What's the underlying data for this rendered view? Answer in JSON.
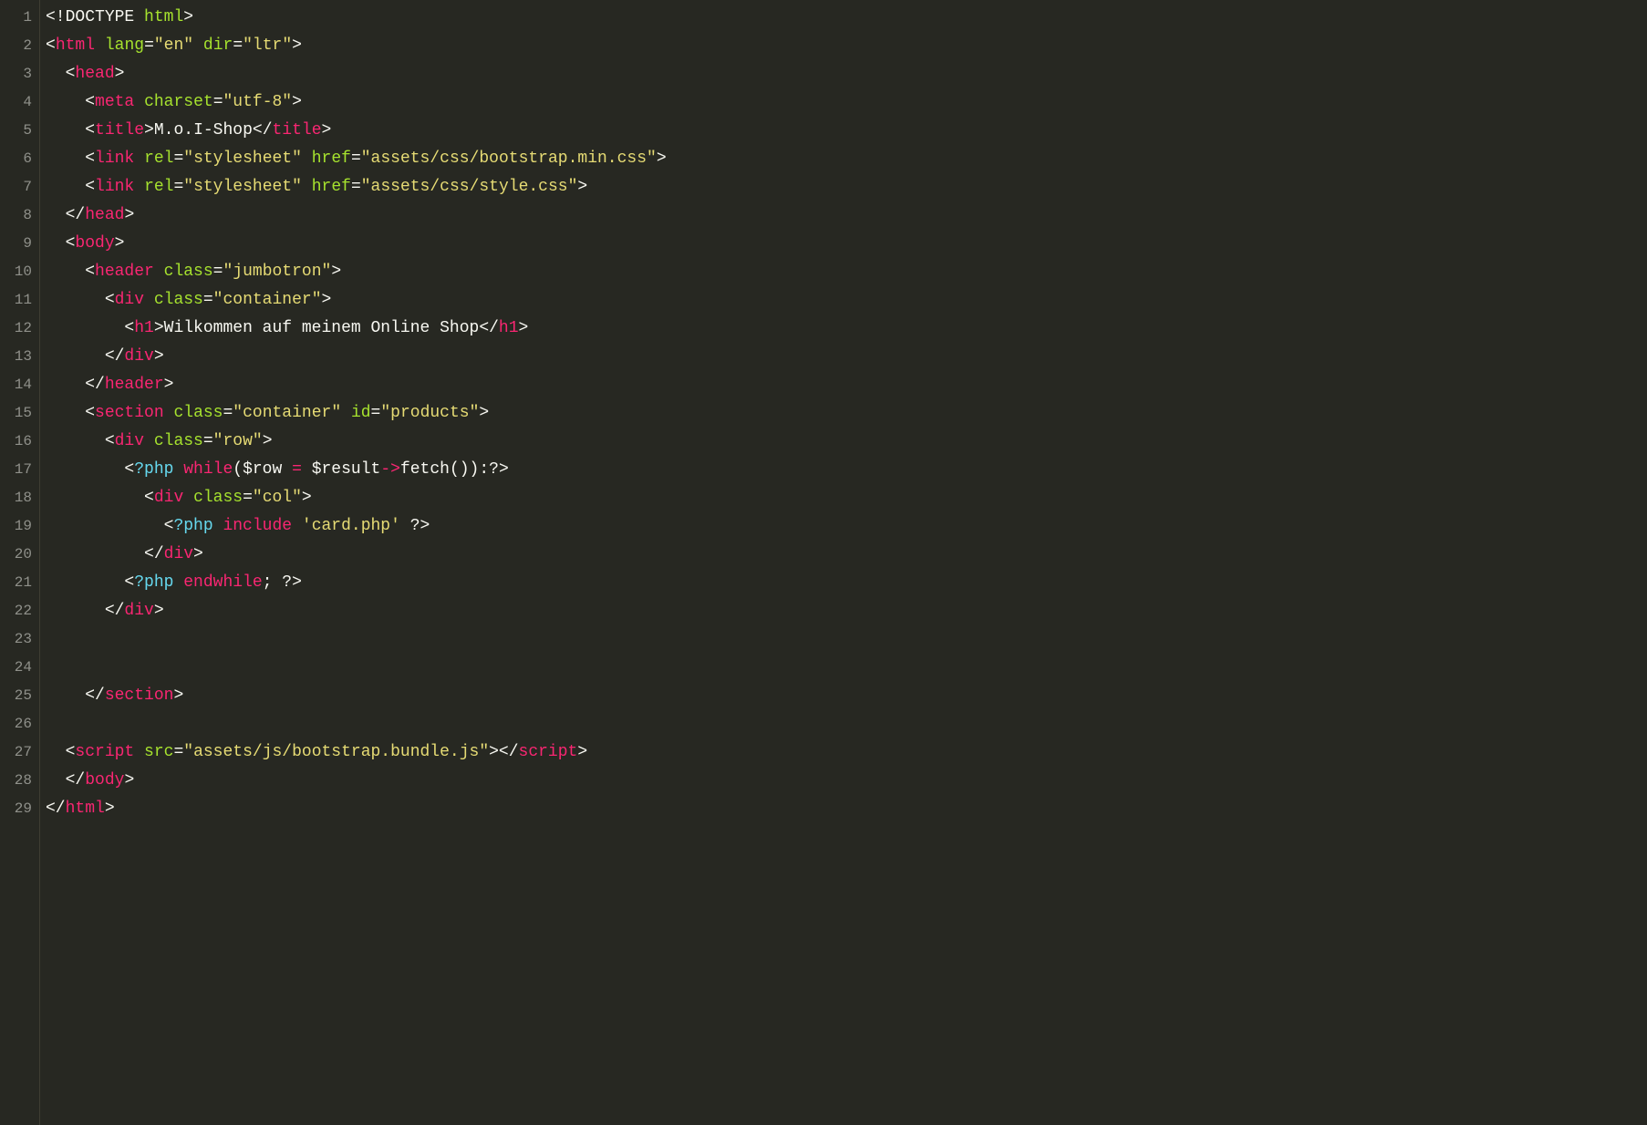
{
  "lineNumbers": [
    "1",
    "2",
    "3",
    "4",
    "5",
    "6",
    "7",
    "8",
    "9",
    "10",
    "11",
    "12",
    "13",
    "14",
    "15",
    "16",
    "17",
    "18",
    "19",
    "20",
    "21",
    "22",
    "23",
    "24",
    "25",
    "26",
    "27",
    "28",
    "29"
  ],
  "code": {
    "lines": [
      {
        "indent": "",
        "tokens": [
          {
            "cls": "pun",
            "t": "<!"
          },
          {
            "cls": "doctype",
            "t": "DOCTYPE"
          },
          {
            "cls": "pun",
            "t": " "
          },
          {
            "cls": "attr",
            "t": "html"
          },
          {
            "cls": "pun",
            "t": ">"
          }
        ]
      },
      {
        "indent": "",
        "tokens": [
          {
            "cls": "pun",
            "t": "<"
          },
          {
            "cls": "tag",
            "t": "html"
          },
          {
            "cls": "pun",
            "t": " "
          },
          {
            "cls": "attr",
            "t": "lang"
          },
          {
            "cls": "pun",
            "t": "="
          },
          {
            "cls": "str",
            "t": "\"en\""
          },
          {
            "cls": "pun",
            "t": " "
          },
          {
            "cls": "attr",
            "t": "dir"
          },
          {
            "cls": "pun",
            "t": "="
          },
          {
            "cls": "str",
            "t": "\"ltr\""
          },
          {
            "cls": "pun",
            "t": ">"
          }
        ]
      },
      {
        "indent": "  ",
        "tokens": [
          {
            "cls": "pun",
            "t": "<"
          },
          {
            "cls": "tag",
            "t": "head"
          },
          {
            "cls": "pun",
            "t": ">"
          }
        ]
      },
      {
        "indent": "    ",
        "tokens": [
          {
            "cls": "pun",
            "t": "<"
          },
          {
            "cls": "tag",
            "t": "meta"
          },
          {
            "cls": "pun",
            "t": " "
          },
          {
            "cls": "attr",
            "t": "charset"
          },
          {
            "cls": "pun",
            "t": "="
          },
          {
            "cls": "str",
            "t": "\"utf-8\""
          },
          {
            "cls": "pun",
            "t": ">"
          }
        ]
      },
      {
        "indent": "    ",
        "tokens": [
          {
            "cls": "pun",
            "t": "<"
          },
          {
            "cls": "tag",
            "t": "title"
          },
          {
            "cls": "pun",
            "t": ">"
          },
          {
            "cls": "txt",
            "t": "M.o.I-Shop"
          },
          {
            "cls": "pun",
            "t": "</"
          },
          {
            "cls": "tag",
            "t": "title"
          },
          {
            "cls": "pun",
            "t": ">"
          }
        ]
      },
      {
        "indent": "    ",
        "tokens": [
          {
            "cls": "pun",
            "t": "<"
          },
          {
            "cls": "tag",
            "t": "link"
          },
          {
            "cls": "pun",
            "t": " "
          },
          {
            "cls": "attr",
            "t": "rel"
          },
          {
            "cls": "pun",
            "t": "="
          },
          {
            "cls": "str",
            "t": "\"stylesheet\""
          },
          {
            "cls": "pun",
            "t": " "
          },
          {
            "cls": "attr",
            "t": "href"
          },
          {
            "cls": "pun",
            "t": "="
          },
          {
            "cls": "str",
            "t": "\"assets/css/bootstrap.min.css\""
          },
          {
            "cls": "pun",
            "t": ">"
          }
        ]
      },
      {
        "indent": "    ",
        "tokens": [
          {
            "cls": "pun",
            "t": "<"
          },
          {
            "cls": "tag",
            "t": "link"
          },
          {
            "cls": "pun",
            "t": " "
          },
          {
            "cls": "attr",
            "t": "rel"
          },
          {
            "cls": "pun",
            "t": "="
          },
          {
            "cls": "str",
            "t": "\"stylesheet\""
          },
          {
            "cls": "pun",
            "t": " "
          },
          {
            "cls": "attr",
            "t": "href"
          },
          {
            "cls": "pun",
            "t": "="
          },
          {
            "cls": "str",
            "t": "\"assets/css/style.css\""
          },
          {
            "cls": "pun",
            "t": ">"
          }
        ]
      },
      {
        "indent": "  ",
        "tokens": [
          {
            "cls": "pun",
            "t": "</"
          },
          {
            "cls": "tag",
            "t": "head"
          },
          {
            "cls": "pun",
            "t": ">"
          }
        ]
      },
      {
        "indent": "  ",
        "tokens": [
          {
            "cls": "pun",
            "t": "<"
          },
          {
            "cls": "tag",
            "t": "body"
          },
          {
            "cls": "pun",
            "t": ">"
          }
        ]
      },
      {
        "indent": "    ",
        "tokens": [
          {
            "cls": "pun",
            "t": "<"
          },
          {
            "cls": "tag",
            "t": "header"
          },
          {
            "cls": "pun",
            "t": " "
          },
          {
            "cls": "attr",
            "t": "class"
          },
          {
            "cls": "pun",
            "t": "="
          },
          {
            "cls": "str",
            "t": "\"jumbotron\""
          },
          {
            "cls": "pun",
            "t": ">"
          }
        ]
      },
      {
        "indent": "      ",
        "tokens": [
          {
            "cls": "pun",
            "t": "<"
          },
          {
            "cls": "tag",
            "t": "div"
          },
          {
            "cls": "pun",
            "t": " "
          },
          {
            "cls": "attr",
            "t": "class"
          },
          {
            "cls": "pun",
            "t": "="
          },
          {
            "cls": "str",
            "t": "\"container\""
          },
          {
            "cls": "pun",
            "t": ">"
          }
        ]
      },
      {
        "indent": "        ",
        "tokens": [
          {
            "cls": "pun",
            "t": "<"
          },
          {
            "cls": "tag",
            "t": "h1"
          },
          {
            "cls": "pun",
            "t": ">"
          },
          {
            "cls": "txt",
            "t": "Wilkommen auf meinem Online Shop"
          },
          {
            "cls": "pun",
            "t": "</"
          },
          {
            "cls": "tag",
            "t": "h1"
          },
          {
            "cls": "pun",
            "t": ">"
          }
        ]
      },
      {
        "indent": "      ",
        "tokens": [
          {
            "cls": "pun",
            "t": "</"
          },
          {
            "cls": "tag",
            "t": "div"
          },
          {
            "cls": "pun",
            "t": ">"
          }
        ]
      },
      {
        "indent": "    ",
        "tokens": [
          {
            "cls": "pun",
            "t": "</"
          },
          {
            "cls": "tag",
            "t": "header"
          },
          {
            "cls": "pun",
            "t": ">"
          }
        ]
      },
      {
        "indent": "    ",
        "tokens": [
          {
            "cls": "pun",
            "t": "<"
          },
          {
            "cls": "tag",
            "t": "section"
          },
          {
            "cls": "pun",
            "t": " "
          },
          {
            "cls": "attr",
            "t": "class"
          },
          {
            "cls": "pun",
            "t": "="
          },
          {
            "cls": "str",
            "t": "\"container\""
          },
          {
            "cls": "pun",
            "t": " "
          },
          {
            "cls": "attr",
            "t": "id"
          },
          {
            "cls": "pun",
            "t": "="
          },
          {
            "cls": "str",
            "t": "\"products\""
          },
          {
            "cls": "pun",
            "t": ">"
          }
        ]
      },
      {
        "indent": "      ",
        "tokens": [
          {
            "cls": "pun",
            "t": "<"
          },
          {
            "cls": "tag",
            "t": "div"
          },
          {
            "cls": "pun",
            "t": " "
          },
          {
            "cls": "attr",
            "t": "class"
          },
          {
            "cls": "pun",
            "t": "="
          },
          {
            "cls": "str",
            "t": "\"row\""
          },
          {
            "cls": "pun",
            "t": ">"
          }
        ]
      },
      {
        "indent": "        ",
        "tokens": [
          {
            "cls": "pun",
            "t": "<"
          },
          {
            "cls": "directive",
            "t": "?php "
          },
          {
            "cls": "kw",
            "t": "while"
          },
          {
            "cls": "pun",
            "t": "("
          },
          {
            "cls": "var",
            "t": "$row "
          },
          {
            "cls": "kw",
            "t": "="
          },
          {
            "cls": "var",
            "t": " $result"
          },
          {
            "cls": "kw",
            "t": "->"
          },
          {
            "cls": "txt",
            "t": "fetch()):"
          },
          {
            "cls": "pun",
            "t": "?>"
          }
        ]
      },
      {
        "indent": "          ",
        "tokens": [
          {
            "cls": "pun",
            "t": "<"
          },
          {
            "cls": "tag",
            "t": "div"
          },
          {
            "cls": "pun",
            "t": " "
          },
          {
            "cls": "attr",
            "t": "class"
          },
          {
            "cls": "pun",
            "t": "="
          },
          {
            "cls": "str",
            "t": "\"col\""
          },
          {
            "cls": "pun",
            "t": ">"
          }
        ]
      },
      {
        "indent": "            ",
        "tokens": [
          {
            "cls": "pun",
            "t": "<"
          },
          {
            "cls": "directive",
            "t": "?php "
          },
          {
            "cls": "kw",
            "t": "include"
          },
          {
            "cls": "pun",
            "t": " "
          },
          {
            "cls": "str",
            "t": "'card.php'"
          },
          {
            "cls": "pun",
            "t": " ?>"
          }
        ]
      },
      {
        "indent": "          ",
        "tokens": [
          {
            "cls": "pun",
            "t": "</"
          },
          {
            "cls": "tag",
            "t": "div"
          },
          {
            "cls": "pun",
            "t": ">"
          }
        ]
      },
      {
        "indent": "        ",
        "tokens": [
          {
            "cls": "pun",
            "t": "<"
          },
          {
            "cls": "directive",
            "t": "?php "
          },
          {
            "cls": "kw",
            "t": "endwhile"
          },
          {
            "cls": "txt",
            "t": "; "
          },
          {
            "cls": "pun",
            "t": "?>"
          }
        ]
      },
      {
        "indent": "      ",
        "tokens": [
          {
            "cls": "pun",
            "t": "</"
          },
          {
            "cls": "tag",
            "t": "div"
          },
          {
            "cls": "pun",
            "t": ">"
          }
        ]
      },
      {
        "indent": "",
        "tokens": []
      },
      {
        "indent": "",
        "tokens": []
      },
      {
        "indent": "    ",
        "tokens": [
          {
            "cls": "pun",
            "t": "</"
          },
          {
            "cls": "tag",
            "t": "section"
          },
          {
            "cls": "pun",
            "t": ">"
          }
        ]
      },
      {
        "indent": "",
        "tokens": []
      },
      {
        "indent": "  ",
        "tokens": [
          {
            "cls": "pun",
            "t": "<"
          },
          {
            "cls": "tag",
            "t": "script"
          },
          {
            "cls": "pun",
            "t": " "
          },
          {
            "cls": "attr",
            "t": "src"
          },
          {
            "cls": "pun",
            "t": "="
          },
          {
            "cls": "str",
            "t": "\"assets/js/bootstrap.bundle.js\""
          },
          {
            "cls": "pun",
            "t": "></"
          },
          {
            "cls": "tag",
            "t": "script"
          },
          {
            "cls": "pun",
            "t": ">"
          }
        ]
      },
      {
        "indent": "  ",
        "tokens": [
          {
            "cls": "pun",
            "t": "</"
          },
          {
            "cls": "tag",
            "t": "body"
          },
          {
            "cls": "pun",
            "t": ">"
          }
        ]
      },
      {
        "indent": "",
        "tokens": [
          {
            "cls": "pun",
            "t": "</"
          },
          {
            "cls": "tag",
            "t": "html"
          },
          {
            "cls": "pun",
            "t": ">"
          }
        ]
      }
    ]
  }
}
